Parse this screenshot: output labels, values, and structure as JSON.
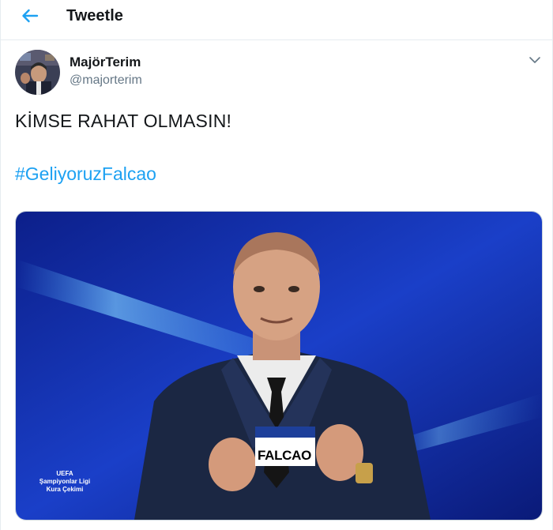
{
  "header": {
    "title": "Tweetle",
    "back_icon": "arrow-left-icon"
  },
  "tweet": {
    "display_name": "MajörTerim",
    "handle": "@majorterim",
    "text": "KİMSE RAHAT OLMASIN!",
    "hashtag": "#GeliyoruzFalcao",
    "menu_icon": "chevron-down-icon"
  },
  "media": {
    "card_text": "FALCAO",
    "watermark_lines": [
      "UEFA",
      "Şampiyonlar Ligi",
      "Kura Çekimi"
    ]
  },
  "colors": {
    "accent": "#1da1f2",
    "muted": "#657786",
    "border": "#e6ecf0"
  }
}
